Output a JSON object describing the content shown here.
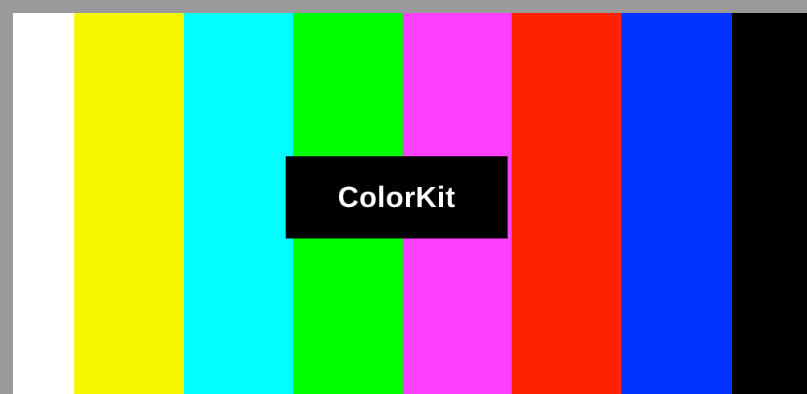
{
  "brand": {
    "name": "ColorKit"
  },
  "color_bars": [
    {
      "name": "white",
      "color": "#ffffff"
    },
    {
      "name": "yellow",
      "color": "#f7f700"
    },
    {
      "name": "cyan",
      "color": "#00ffff"
    },
    {
      "name": "green",
      "color": "#00ff00"
    },
    {
      "name": "magenta",
      "color": "#ff40ff"
    },
    {
      "name": "red",
      "color": "#ff2200"
    },
    {
      "name": "blue",
      "color": "#0033ff"
    },
    {
      "name": "black",
      "color": "#000000"
    }
  ],
  "colors": {
    "frame": "#9a9a9a",
    "logo_background": "#000000",
    "logo_text": "#ffffff"
  }
}
